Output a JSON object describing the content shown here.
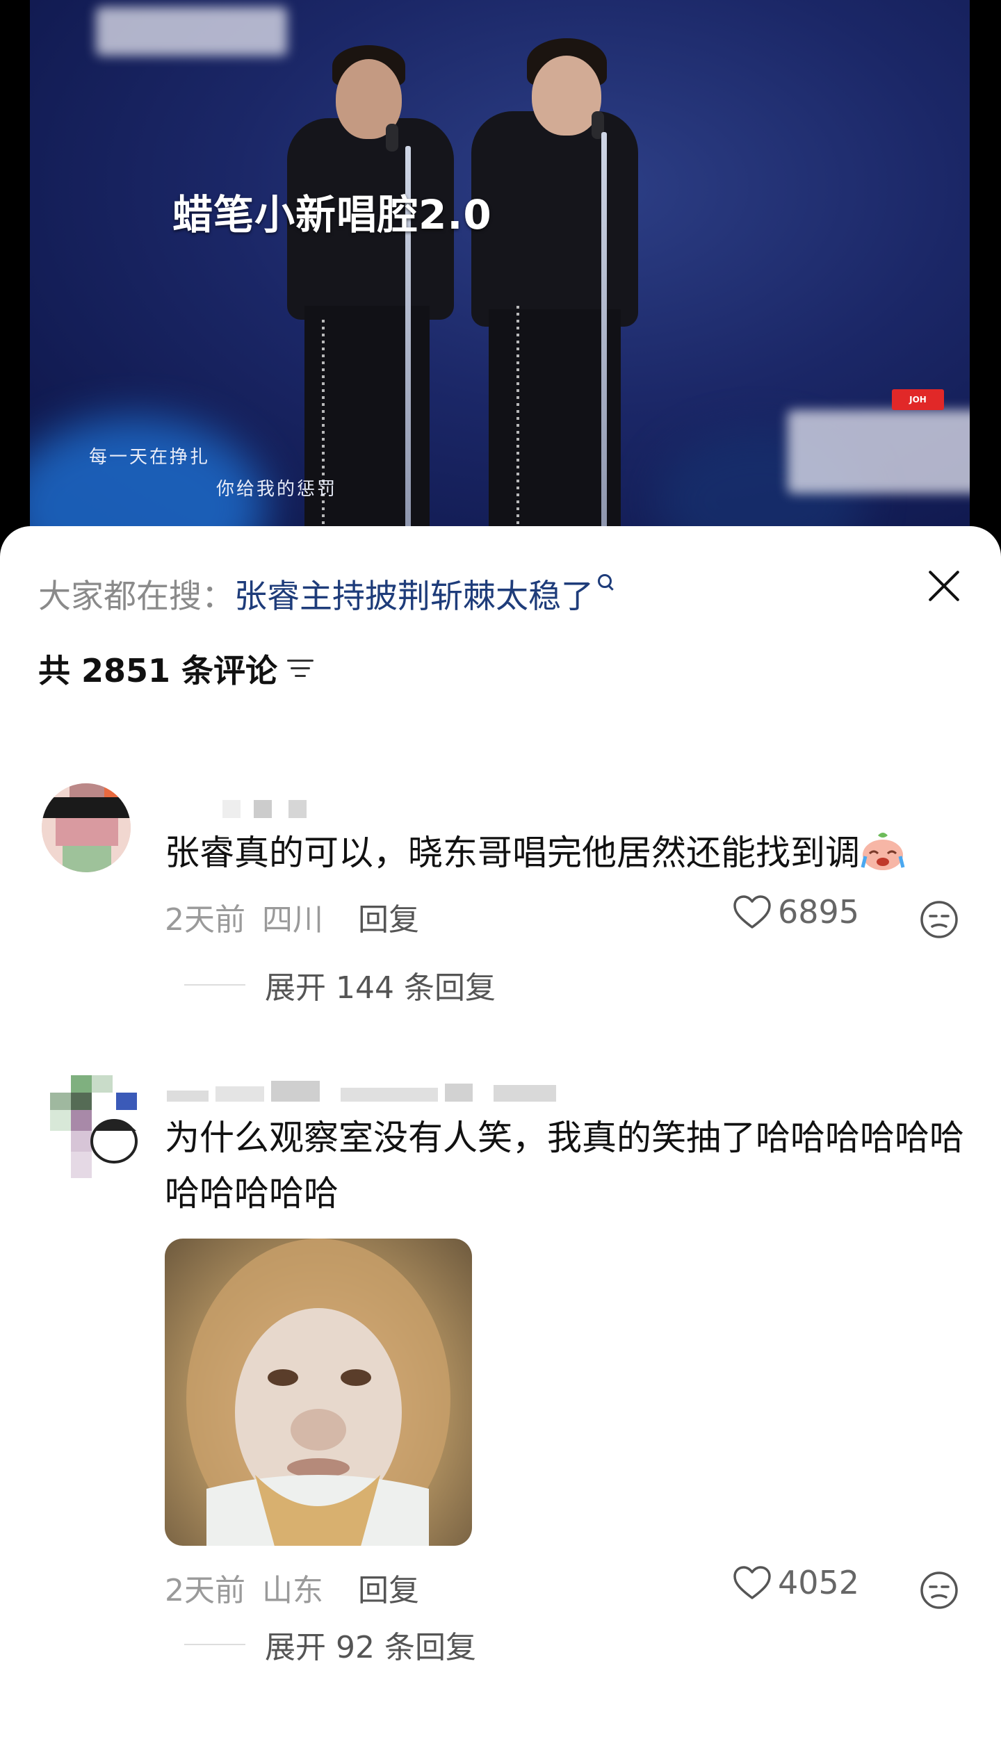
{
  "video": {
    "overlay_title": "蜡笔小新唱腔2.0",
    "subtitle_line1": "每一天在挣扎",
    "subtitle_line2": "你给我的惩罚",
    "brand_badge": "JOH"
  },
  "sheet": {
    "search_prefix": "大家都在搜：",
    "search_term": "张睿主持披荆斩棘太稳了",
    "comment_count_label": "共 2851 条评论"
  },
  "comments": [
    {
      "username": "",
      "text": "张睿真的可以，晓东哥唱完他居然还能找到调",
      "time": "2天前",
      "location": "四川",
      "reply_label": "回复",
      "likes": "6895",
      "expand_label": "展开 144 条回复"
    },
    {
      "username": "",
      "text": "为什么观察室没有人笑，我真的笑抽了哈哈哈哈哈哈哈哈哈哈哈",
      "time": "2天前",
      "location": "山东",
      "reply_label": "回复",
      "likes": "4052",
      "expand_label": "展开 92 条回复"
    }
  ],
  "colors": {
    "link": "#1e3c7a",
    "muted": "#9a9a9a",
    "text": "#111111"
  }
}
